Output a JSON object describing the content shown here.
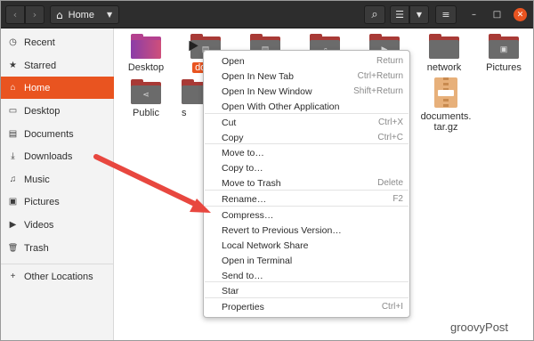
{
  "header": {
    "back_icon": "‹",
    "forward_icon": "›",
    "location": "Home",
    "home_icon": "⌂",
    "dropdown_icon": "▼",
    "search_icon": "⌕",
    "view_list_icon": "☰",
    "view_menu_icon": "▼",
    "menu_icon": "≡",
    "minimize_icon": "–",
    "maximize_icon": "□",
    "close_icon": "✕"
  },
  "sidebar": {
    "items": [
      {
        "label": "Recent",
        "icon": "◷"
      },
      {
        "label": "Starred",
        "icon": "★"
      },
      {
        "label": "Home",
        "icon": "⌂",
        "active": true
      },
      {
        "label": "Desktop",
        "icon": "▭"
      },
      {
        "label": "Documents",
        "icon": "▤"
      },
      {
        "label": "Downloads",
        "icon": "⤓"
      },
      {
        "label": "Music",
        "icon": "♫"
      },
      {
        "label": "Pictures",
        "icon": "▣"
      },
      {
        "label": "Videos",
        "icon": "▶"
      },
      {
        "label": "Trash",
        "icon": "🗑"
      }
    ],
    "other_locations": {
      "label": "Other Locations",
      "icon": "+"
    }
  },
  "files": {
    "desktop": "Desktop",
    "documents_selected": "docu",
    "network": "network",
    "pictures": "Pictures",
    "public": "Public",
    "partial_s": "s",
    "archive": "documents.\ntar.gz",
    "archive_line1": "documents.",
    "archive_line2": "tar.gz"
  },
  "context_menu": {
    "items": [
      {
        "label": "Open",
        "accel": "Return"
      },
      {
        "label": "Open In New Tab",
        "accel": "Ctrl+Return"
      },
      {
        "label": "Open In New Window",
        "accel": "Shift+Return"
      },
      {
        "label": "Open With Other Application",
        "accel": ""
      },
      {
        "label": "Cut",
        "accel": "Ctrl+X"
      },
      {
        "label": "Copy",
        "accel": "Ctrl+C"
      },
      {
        "label": "Move to…",
        "accel": ""
      },
      {
        "label": "Copy to…",
        "accel": ""
      },
      {
        "label": "Move to Trash",
        "accel": "Delete"
      },
      {
        "label": "Rename…",
        "accel": "F2"
      },
      {
        "label": "Compress…",
        "accel": ""
      },
      {
        "label": "Revert to Previous Version…",
        "accel": ""
      },
      {
        "label": "Local Network Share",
        "accel": ""
      },
      {
        "label": "Open in Terminal",
        "accel": ""
      },
      {
        "label": "Send to…",
        "accel": ""
      },
      {
        "label": "Star",
        "accel": ""
      },
      {
        "label": "Properties",
        "accel": "Ctrl+I"
      }
    ]
  },
  "watermark": "groovyPost",
  "colors": {
    "accent": "#e95420",
    "arrow": "#e8473f",
    "headerbar": "#2d2d2d"
  }
}
